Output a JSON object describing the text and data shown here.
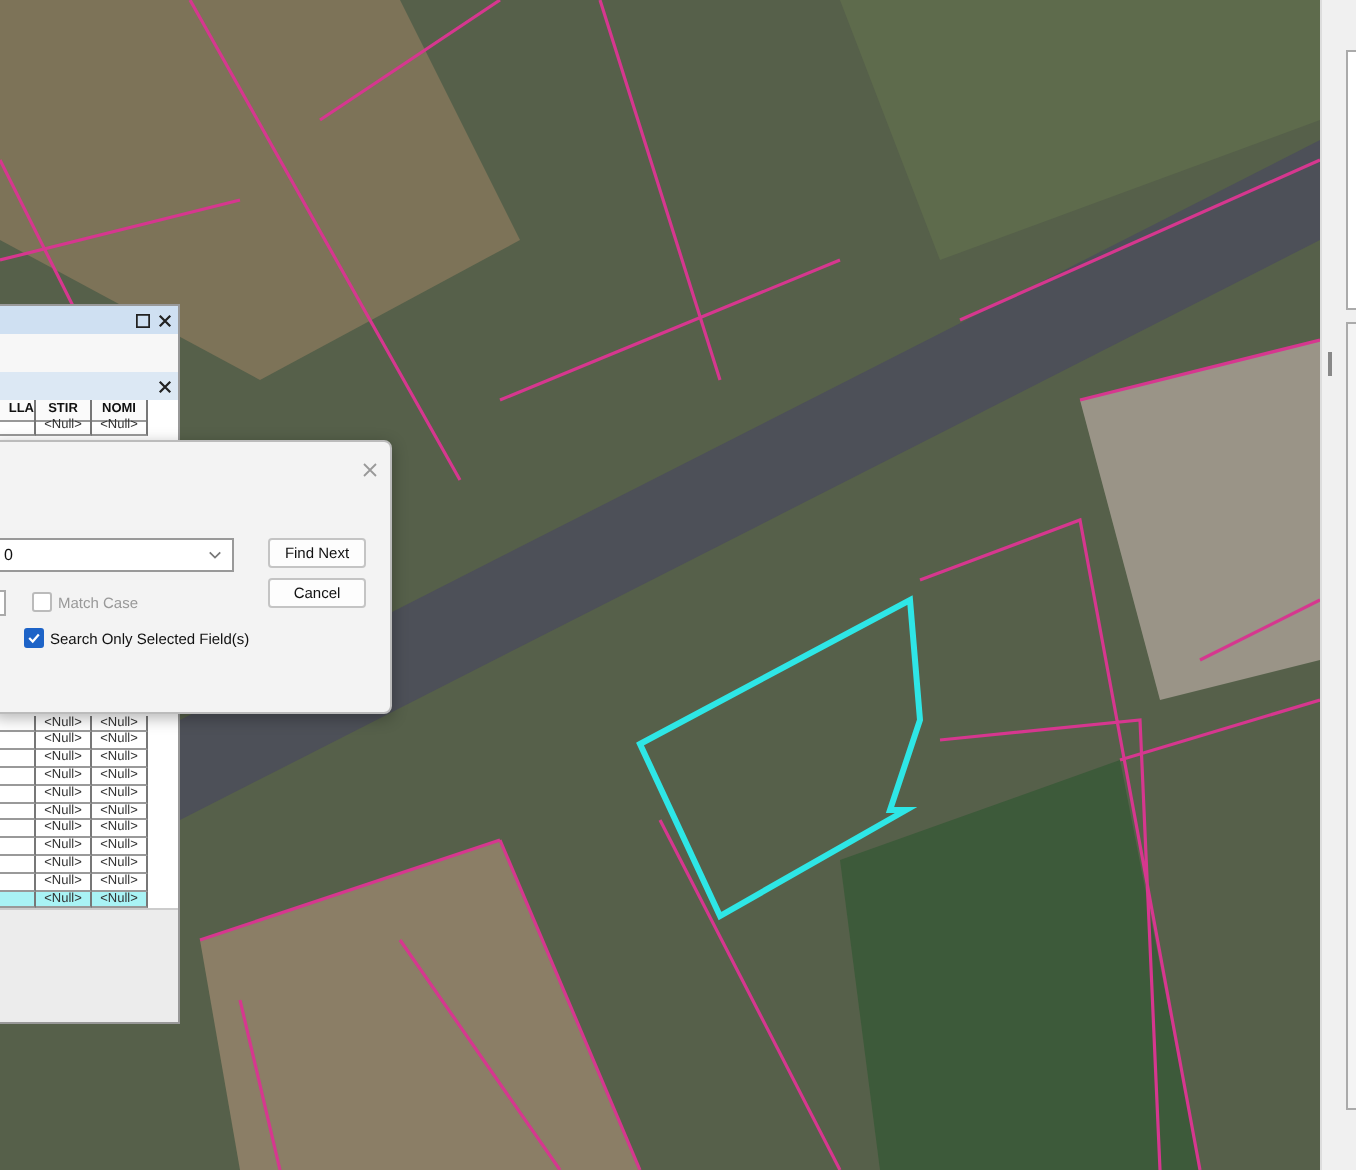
{
  "attribute_table": {
    "columns": [
      "LLA",
      "STIR",
      "NOMI"
    ],
    "rows_top": [
      {
        "cells": [
          "<Null>",
          "<Null>"
        ],
        "selected": false
      }
    ],
    "rows_bottom": [
      {
        "cells": [
          "<Null>",
          "<Null>"
        ],
        "selected": false
      },
      {
        "cells": [
          "<Null>",
          "<Null>"
        ],
        "selected": false
      },
      {
        "cells": [
          "<Null>",
          "<Null>"
        ],
        "selected": false
      },
      {
        "cells": [
          "<Null>",
          "<Null>"
        ],
        "selected": false
      },
      {
        "cells": [
          "<Null>",
          "<Null>"
        ],
        "selected": false
      },
      {
        "cells": [
          "<Null>",
          "<Null>"
        ],
        "selected": false
      },
      {
        "cells": [
          "<Null>",
          "<Null>"
        ],
        "selected": false
      },
      {
        "cells": [
          "<Null>",
          "<Null>"
        ],
        "selected": false
      },
      {
        "cells": [
          "<Null>",
          "<Null>"
        ],
        "selected": false
      },
      {
        "cells": [
          "<Null>",
          "<Null>"
        ],
        "selected": false
      },
      {
        "cells": [
          "<Null>",
          "<Null>"
        ],
        "selected": true
      }
    ]
  },
  "find_dialog": {
    "find_value": "0",
    "buttons": [
      "Find Next",
      "Cancel"
    ],
    "options": [
      {
        "label": "Match Case",
        "checked": false,
        "disabled": true
      },
      {
        "label": "Search Only Selected Field(s)",
        "checked": true,
        "disabled": false
      }
    ]
  }
}
